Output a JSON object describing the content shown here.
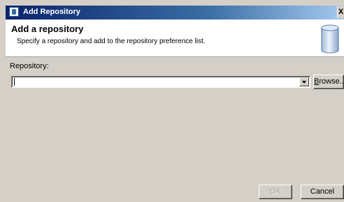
{
  "window": {
    "title": "Add Repository",
    "close_glyph": "X"
  },
  "banner": {
    "heading": "Add a repository",
    "description": "Specify a repository and add to the repository preference list.",
    "icon": "repository-cylinder-icon"
  },
  "form": {
    "repository_label": "Repository:",
    "repository_value": "",
    "browse_label_first": "B",
    "browse_label_rest": "rowse..."
  },
  "buttons": {
    "ok": "OK",
    "cancel": "Cancel"
  },
  "colors": {
    "titlebar_start": "#0a246a",
    "titlebar_end": "#a6caf0",
    "dialog_face": "#d4d0c8",
    "banner_bg": "#ffffff"
  }
}
